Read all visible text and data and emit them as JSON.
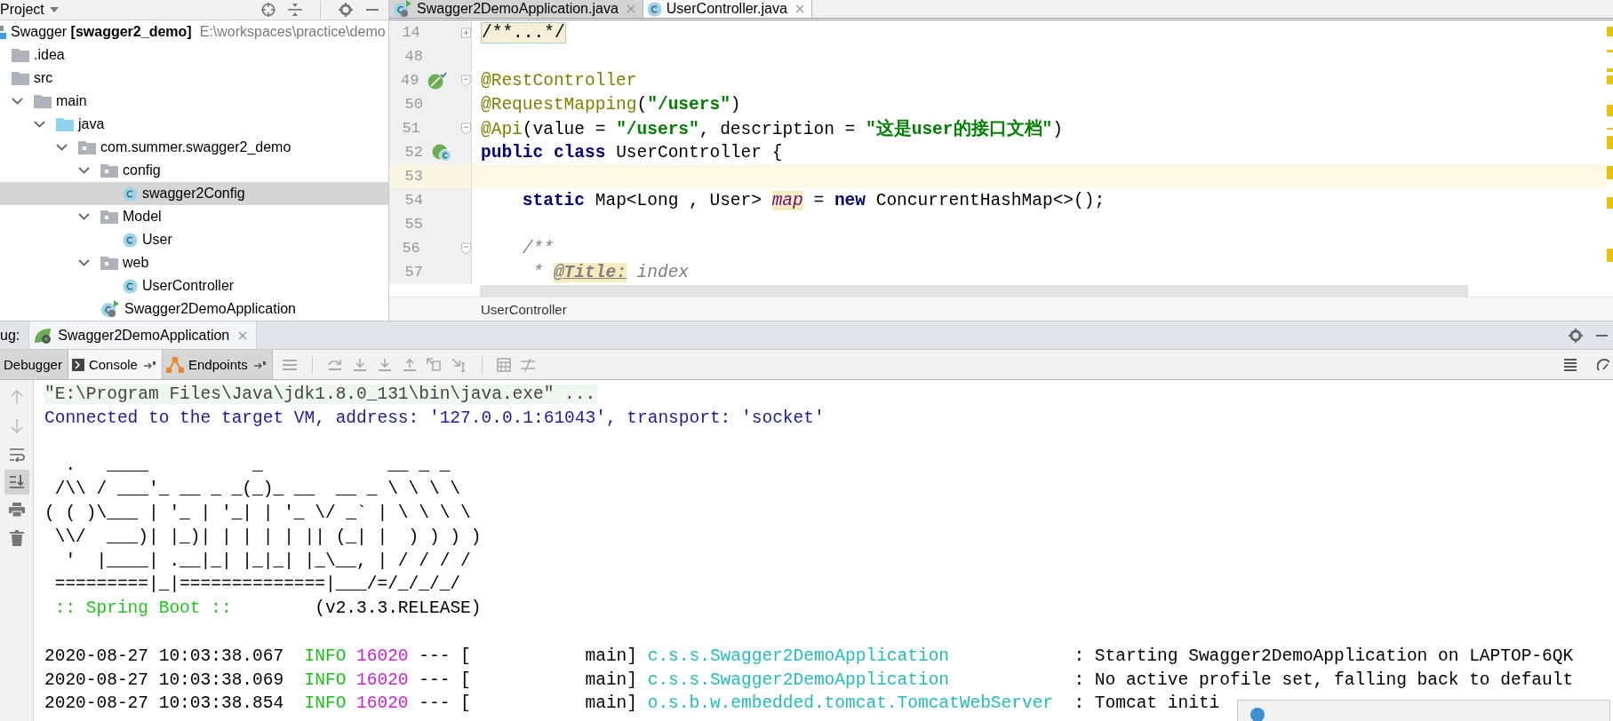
{
  "project_panel": {
    "title": "Project",
    "tree": {
      "label": "Swagger **[swagger2_demo]**",
      "path": "E:\\workspaces\\practice\\demo",
      "kind": "module",
      "selected": false,
      "children": [
        {
          "label": ".idea",
          "kind": "folder",
          "selected": false
        },
        {
          "label": "src",
          "kind": "folder",
          "selected": false,
          "children": [
            {
              "label": "main",
              "kind": "folder",
              "expanded": true,
              "selected": false,
              "children": [
                {
                  "label": "java",
                  "kind": "source-folder",
                  "expanded": true,
                  "selected": false,
                  "children": [
                    {
                      "label": "com.summer.swagger2_demo",
                      "kind": "package",
                      "expanded": true,
                      "selected": false,
                      "children": [
                        {
                          "label": "config",
                          "kind": "package",
                          "expanded": true,
                          "selected": false,
                          "children": [
                            {
                              "label": "swagger2Config",
                              "kind": "class",
                              "selected": true
                            }
                          ]
                        },
                        {
                          "label": "Model",
                          "kind": "package",
                          "expanded": true,
                          "selected": false,
                          "children": [
                            {
                              "label": "User",
                              "kind": "class",
                              "selected": false
                            }
                          ]
                        },
                        {
                          "label": "web",
                          "kind": "package",
                          "expanded": true,
                          "selected": false,
                          "children": [
                            {
                              "label": "UserController",
                              "kind": "class",
                              "selected": false
                            }
                          ]
                        },
                        {
                          "label": "Swagger2DemoApplication",
                          "kind": "spring-class",
                          "selected": false
                        }
                      ]
                    }
                  ]
                }
              ]
            }
          ]
        }
      ]
    }
  },
  "editor": {
    "tabs": [
      {
        "label": "Swagger2DemoApplication.java",
        "kind": "spring-class",
        "selected": false
      },
      {
        "label": "UserController.java",
        "kind": "class",
        "selected": true
      }
    ],
    "lines": [
      {
        "number": "14",
        "current": false,
        "kind": "folded",
        "tokens": [
          {
            "text": "/**...*/",
            "kind": "folded"
          }
        ]
      },
      {
        "number": "48",
        "current": false,
        "kind": "plain"
      },
      {
        "number": "49",
        "current": false,
        "kind": "bean",
        "tokens": [
          {
            "text": "@RestController",
            "kind": "annotation"
          }
        ]
      },
      {
        "number": "50",
        "current": false,
        "kind": "plain",
        "tokens": [
          {
            "text": "@RequestMapping",
            "kind": "annotation"
          },
          {
            "text": "(",
            "kind": "plain"
          },
          {
            "text": "\"/users\"",
            "kind": "string"
          },
          {
            "text": ")",
            "kind": "plain"
          }
        ]
      },
      {
        "number": "51",
        "current": false,
        "kind": "fold-start",
        "tokens": [
          {
            "text": "@Api",
            "kind": "annotation"
          },
          {
            "text": "(value = ",
            "kind": "plain"
          },
          {
            "text": "\"/users\"",
            "kind": "string"
          },
          {
            "text": ", description = ",
            "kind": "plain"
          },
          {
            "text": "\"这是user的接口文档\"",
            "kind": "string"
          },
          {
            "text": ")",
            "kind": "plain"
          }
        ]
      },
      {
        "number": "52",
        "current": false,
        "kind": "class-declaration",
        "tokens": [
          {
            "text": "public class",
            "kind": "keyword"
          },
          {
            "text": " UserController {",
            "kind": "plain"
          }
        ]
      },
      {
        "number": "53",
        "current": true,
        "kind": "plain"
      },
      {
        "number": "54",
        "current": false,
        "kind": "plain",
        "tokens": [
          {
            "text": "    static",
            "kind": "keyword"
          },
          {
            "text": " Map<Long , User> ",
            "kind": "plain"
          },
          {
            "text": "map",
            "kind": "field"
          },
          {
            "text": " = ",
            "kind": "plain"
          },
          {
            "text": "new",
            "kind": "keyword"
          },
          {
            "text": " ConcurrentHashMap<>();",
            "kind": "plain"
          }
        ]
      },
      {
        "number": "55",
        "current": false,
        "kind": "plain"
      },
      {
        "number": "56",
        "current": false,
        "kind": "fold-start",
        "tokens": [
          {
            "text": "    /**",
            "kind": "comment"
          }
        ]
      },
      {
        "number": "57",
        "current": false,
        "kind": "plain",
        "tokens": [
          {
            "text": "     * ",
            "kind": "comment"
          },
          {
            "text": "@Title:",
            "kind": "doctag"
          },
          {
            "text": " index",
            "kind": "comment"
          }
        ]
      }
    ],
    "breadcrumb": "UserController"
  },
  "debug": {
    "label": "ug:",
    "tabs": [
      {
        "label": "Swagger2DemoApplication",
        "selected": true
      }
    ],
    "panel_tabs": [
      {
        "label": "Debugger",
        "kind": "debugger",
        "selected": false,
        "pinned": false
      },
      {
        "label": "Console",
        "kind": "console",
        "selected": true,
        "pinned": true
      },
      {
        "label": "Endpoints",
        "kind": "endpoints",
        "selected": false,
        "pinned": true
      }
    ]
  },
  "console": {
    "lines": [
      {
        "kind": "command",
        "text": "\"E:\\Program Files\\Java\\jdk1.8.0_131\\bin\\java.exe\" ..."
      },
      {
        "kind": "system",
        "text": "Connected to the target VM, address: '127.0.0.1:61043', transport: 'socket'"
      },
      {
        "kind": "blank"
      },
      {
        "kind": "banner",
        "text": "  .   ____          _            __ _ _"
      },
      {
        "kind": "banner",
        "text": " /\\\\ / ___'_ __ _ _(_)_ __  __ _ \\ \\ \\ \\"
      },
      {
        "kind": "banner",
        "text": "( ( )\\___ | '_ | '_| | '_ \\/ _` | \\ \\ \\ \\"
      },
      {
        "kind": "banner",
        "text": " \\\\/  ___)| |_)| | | | | || (_| |  ) ) ) )"
      },
      {
        "kind": "banner",
        "text": "  '  |____| .__|_| |_|_| |_\\__, | / / / /"
      },
      {
        "kind": "banner",
        "text": " =========|_|==============|___/=/_/_/_/"
      },
      {
        "kind": "boot",
        "label": " :: Spring Boot ::",
        "version": "        (v2.3.3.RELEASE)"
      },
      {
        "kind": "blank"
      },
      {
        "kind": "log",
        "time": "2020-08-27 10:03:38.067",
        "level": "INFO",
        "pid": "16020",
        "thread": "--- [           main]",
        "logger": "c.s.s.Swagger2DemoApplication",
        "message": ": Starting Swagger2DemoApplication on LAPTOP-6QK"
      },
      {
        "kind": "log",
        "time": "2020-08-27 10:03:38.069",
        "level": "INFO",
        "pid": "16020",
        "thread": "--- [           main]",
        "logger": "c.s.s.Swagger2DemoApplication",
        "message": ": No active profile set, falling back to default"
      },
      {
        "kind": "log",
        "time": "2020-08-27 10:03:38.854",
        "level": "INFO",
        "pid": "16020",
        "thread": "--- [           main]",
        "logger": "o.s.b.w.embedded.tomcat.TomcatWebServer",
        "message": ": Tomcat initi"
      }
    ]
  }
}
